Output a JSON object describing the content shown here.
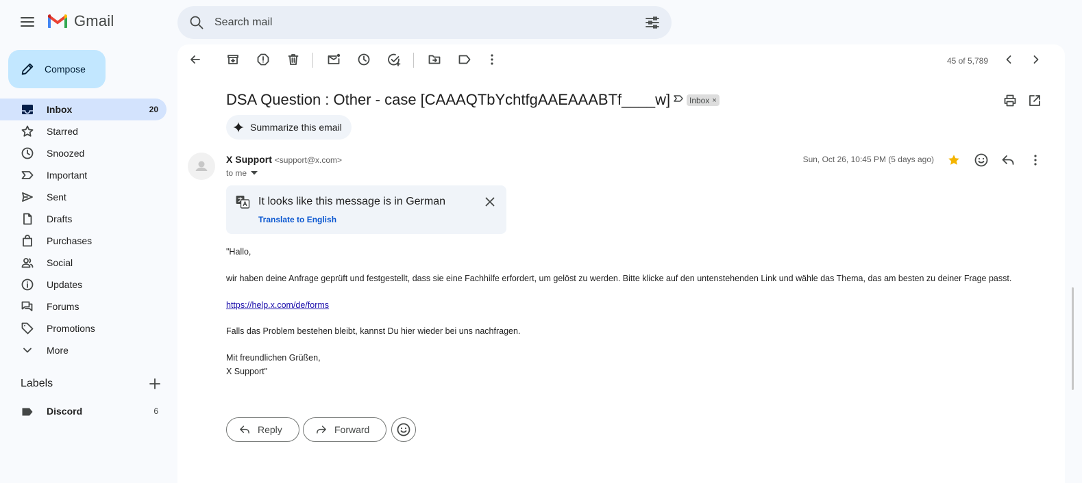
{
  "app": {
    "logo_text": "Gmail"
  },
  "search": {
    "placeholder": "Search mail"
  },
  "sidebar": {
    "compose_label": "Compose",
    "items": [
      {
        "label": "Inbox",
        "count": "20",
        "icon": "inbox-icon",
        "active": true
      },
      {
        "label": "Starred",
        "count": "",
        "icon": "star-icon"
      },
      {
        "label": "Snoozed",
        "count": "",
        "icon": "clock-icon"
      },
      {
        "label": "Important",
        "count": "",
        "icon": "important-icon"
      },
      {
        "label": "Sent",
        "count": "",
        "icon": "send-icon"
      },
      {
        "label": "Drafts",
        "count": "",
        "icon": "draft-icon"
      },
      {
        "label": "Purchases",
        "count": "",
        "icon": "shopping-bag-icon"
      },
      {
        "label": "Social",
        "count": "",
        "icon": "people-icon"
      },
      {
        "label": "Updates",
        "count": "",
        "icon": "info-icon"
      },
      {
        "label": "Forums",
        "count": "",
        "icon": "forum-icon"
      },
      {
        "label": "Promotions",
        "count": "",
        "icon": "tag-icon"
      },
      {
        "label": "More",
        "count": "",
        "icon": "chevron-down-icon"
      }
    ],
    "labels_heading": "Labels",
    "labels": [
      {
        "label": "Discord",
        "count": "6"
      }
    ]
  },
  "toolbar": {
    "page_count": "45 of 5,789"
  },
  "email": {
    "subject": "DSA Question : Other - case [CAAAQTbYchtfgAAEAAABTf____w]",
    "chip_label": "Inbox",
    "chip_close": "×",
    "summarize_label": "Summarize this email",
    "sender_name": "X Support",
    "sender_email": "<support@x.com>",
    "to_line": "to me",
    "date": "Sun, Oct 26, 10:45 PM (5 days ago)",
    "translate_title": "It looks like this message is in German",
    "translate_link": "Translate to English",
    "body": {
      "greeting": "\"Hallo,",
      "paragraph1": "wir haben deine Anfrage geprüft und festgestellt, dass sie eine Fachhilfe erfordert, um gelöst zu werden. Bitte klicke auf den untenstehenden Link und wähle das Thema, das am besten zu deiner Frage passt.",
      "link": "https://help.x.com/de/forms",
      "paragraph2": "Falls das Problem bestehen bleibt, kannst Du hier wieder bei uns nachfragen.",
      "closing": "Mit freundlichen Grüßen,",
      "signature": "X Support\""
    },
    "reply_label": "Reply",
    "forward_label": "Forward"
  },
  "colors": {
    "compose_bg": "#c2e7ff",
    "active_nav_bg": "#d3e3fd",
    "search_bg": "#e9eef6",
    "star": "#f4b400",
    "link": "#0b57d0"
  }
}
